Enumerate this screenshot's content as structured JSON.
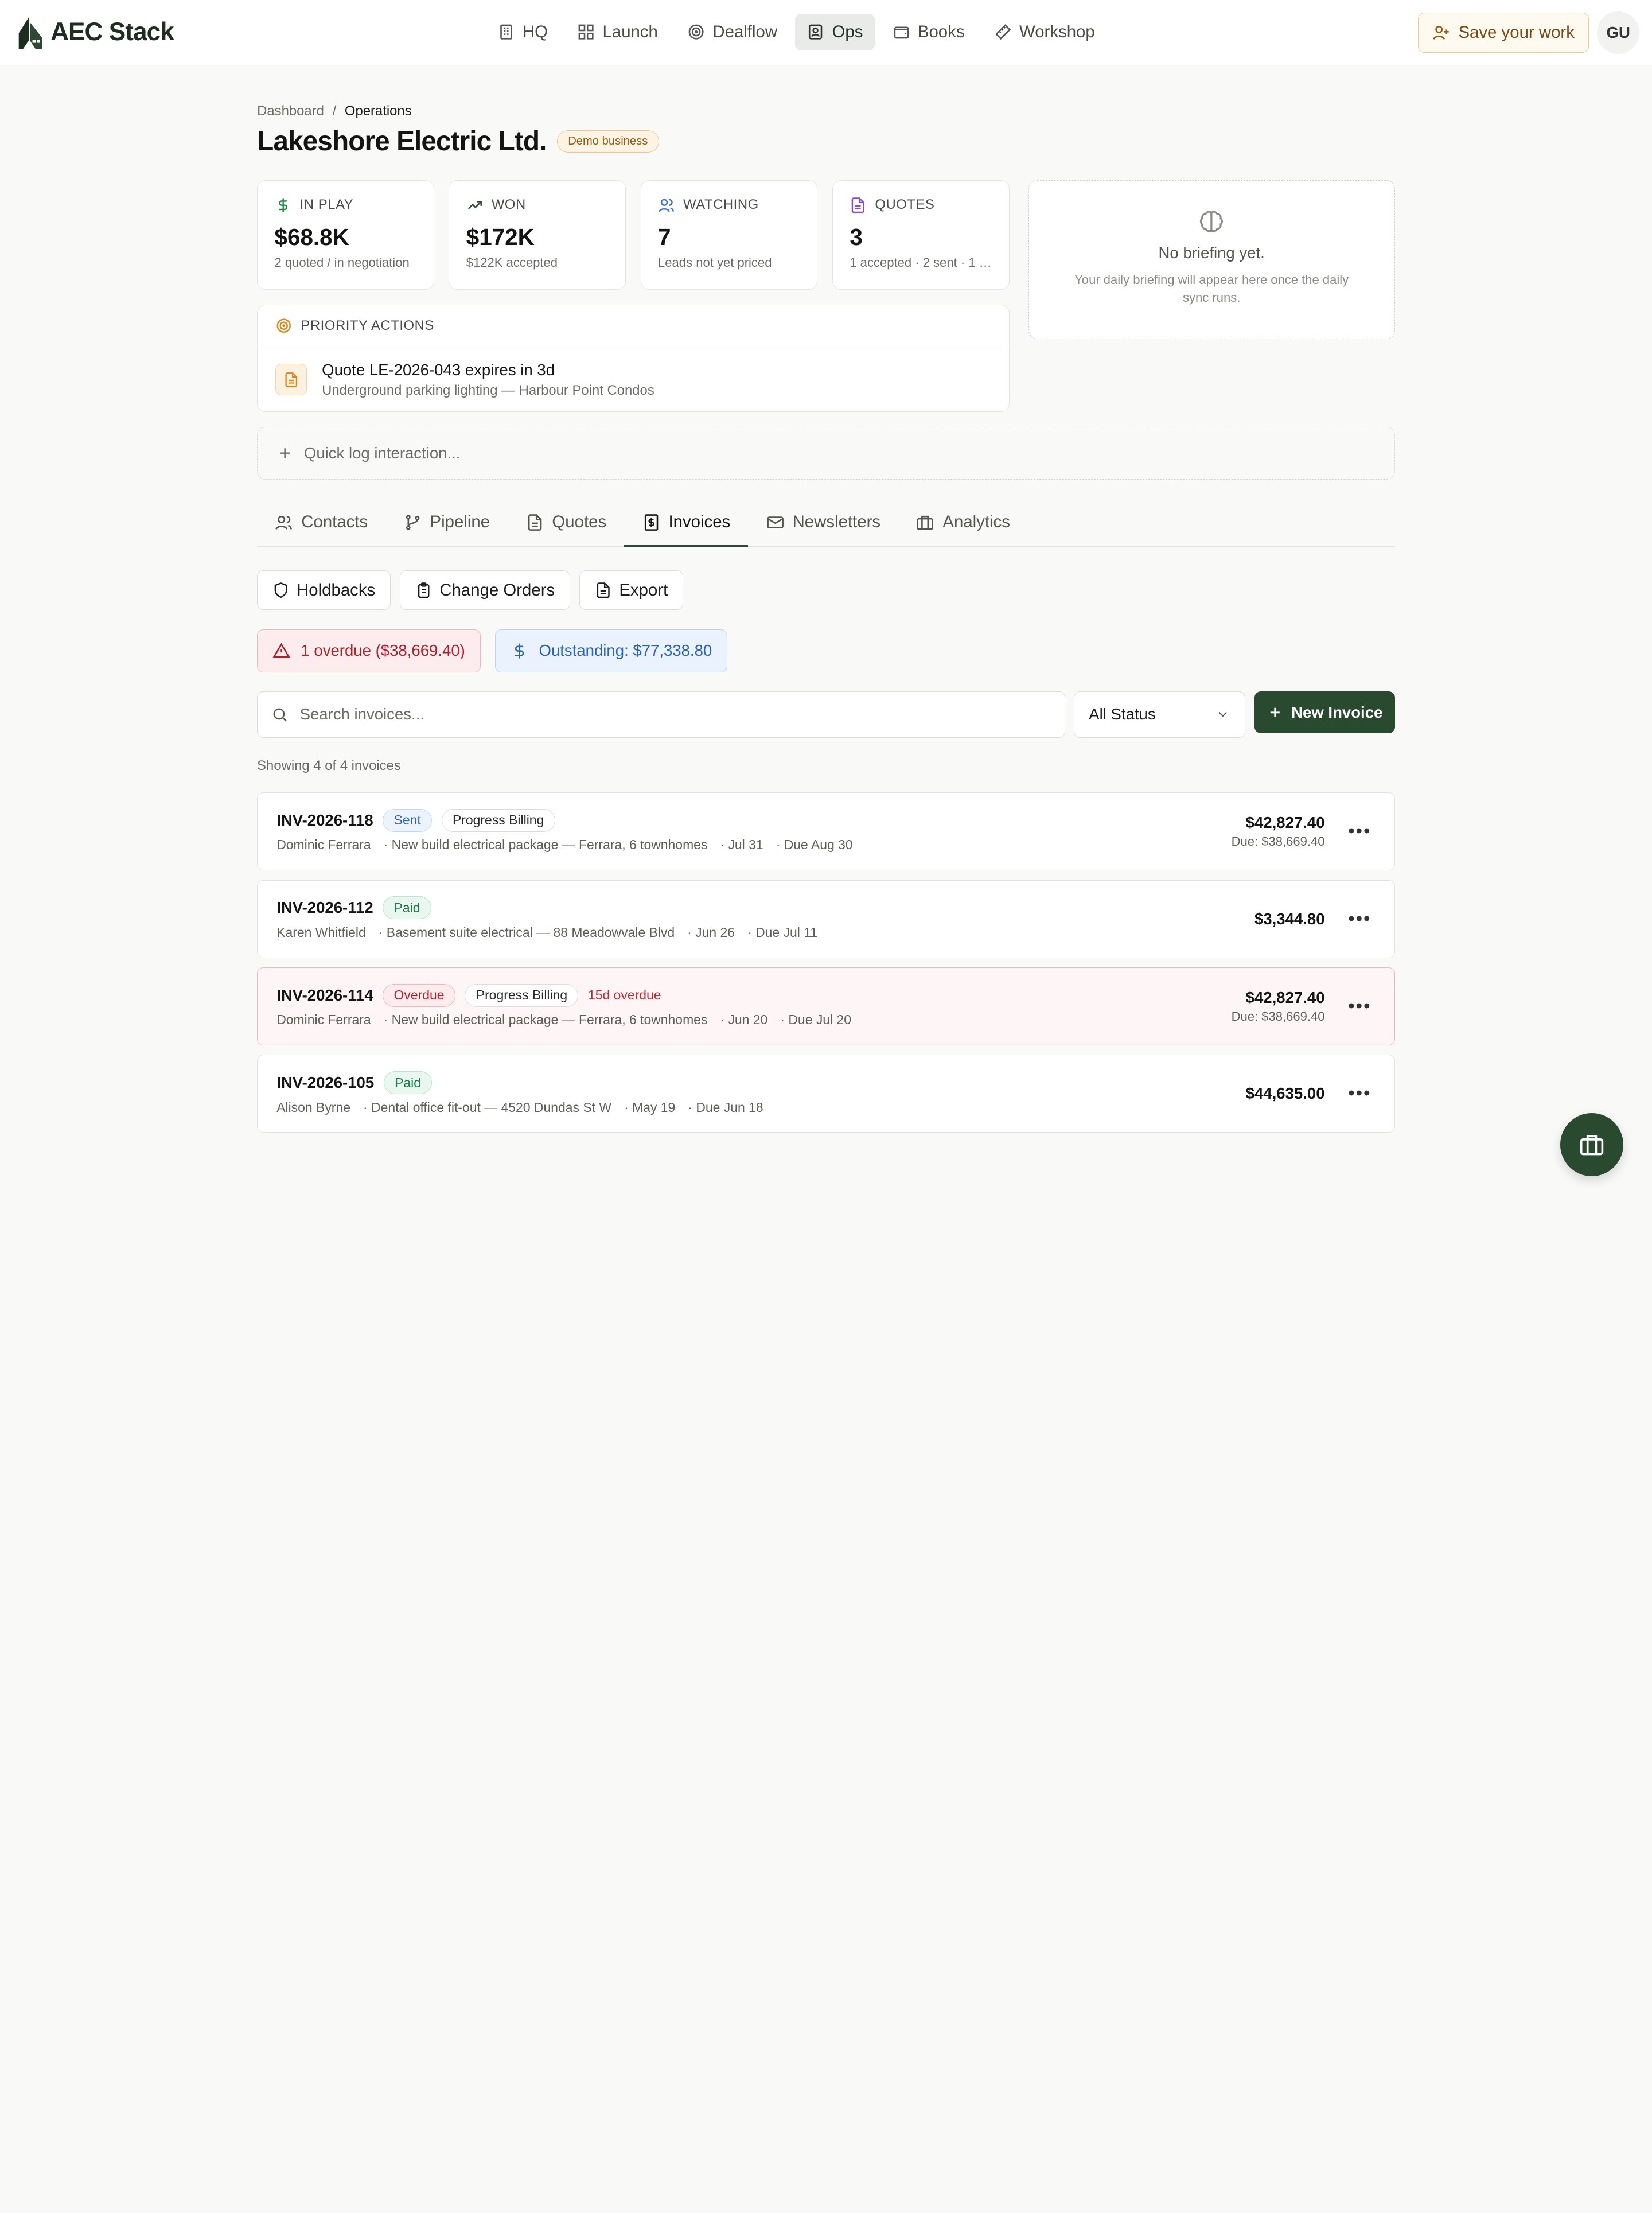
{
  "app": {
    "brand": "AEC Stack",
    "nav": [
      "HQ",
      "Launch",
      "Dealflow",
      "Ops",
      "Books",
      "Workshop"
    ],
    "active_nav": "Ops",
    "save_label": "Save your work",
    "user_initials": "GU"
  },
  "breadcrumb": {
    "root": "Dashboard",
    "sep": "/",
    "current": "Operations"
  },
  "page": {
    "title": "Lakeshore Electric Ltd.",
    "badge": "Demo business"
  },
  "stats": [
    {
      "label": "IN PLAY",
      "value": "$68.8K",
      "sub": "2 quoted / in negotiation",
      "icon": "dollar-icon",
      "color": "#2a8a4a"
    },
    {
      "label": "WON",
      "value": "$172K",
      "sub": "$122K accepted",
      "icon": "trending-up-icon",
      "color": "#2a4a30"
    },
    {
      "label": "WATCHING",
      "value": "7",
      "sub": "Leads not yet priced",
      "icon": "users-icon",
      "color": "#3a6fd8"
    },
    {
      "label": "QUOTES",
      "value": "3",
      "sub": "1 accepted · 2 sent · 1 d...",
      "icon": "file-icon",
      "color": "#8a4ad8"
    }
  ],
  "briefing": {
    "title": "No briefing yet.",
    "sub": "Your daily briefing will appear here once the daily sync runs."
  },
  "priority": {
    "heading": "PRIORITY ACTIONS",
    "items": [
      {
        "title": "Quote LE-2026-043 expires in 3d",
        "sub": "Underground parking lighting — Harbour Point Condos"
      }
    ]
  },
  "quicklog": {
    "label": "Quick log interaction..."
  },
  "tabs": [
    "Contacts",
    "Pipeline",
    "Quotes",
    "Invoices",
    "Newsletters",
    "Analytics"
  ],
  "active_tab": "Invoices",
  "subactions": [
    "Holdbacks",
    "Change Orders",
    "Export"
  ],
  "alerts": {
    "overdue": "1 overdue ($38,669.40)",
    "outstanding": "Outstanding: $77,338.80"
  },
  "search": {
    "placeholder": "Search invoices..."
  },
  "status_filter": {
    "selected": "All Status"
  },
  "new_invoice_label": "New Invoice",
  "showing": "Showing 4 of 4 invoices",
  "invoices": [
    {
      "number": "INV-2026-118",
      "status": "Sent",
      "type": "Progress Billing",
      "note": "",
      "client": "Dominic Ferrara",
      "project": "· New build electrical package — Ferrara, 6 townhomes",
      "date": "· Jul 31",
      "due": "· Due Aug 30",
      "total": "$42,827.40",
      "due_amount": "Due: $38,669.40"
    },
    {
      "number": "INV-2026-112",
      "status": "Paid",
      "type": "",
      "note": "",
      "client": "Karen Whitfield",
      "project": "· Basement suite electrical — 88 Meadowvale Blvd",
      "date": "· Jun 26",
      "due": "· Due Jul 11",
      "total": "$3,344.80",
      "due_amount": ""
    },
    {
      "number": "INV-2026-114",
      "status": "Overdue",
      "type": "Progress Billing",
      "note": "15d overdue",
      "client": "Dominic Ferrara",
      "project": "· New build electrical package — Ferrara, 6 townhomes",
      "date": "· Jun 20",
      "due": "· Due Jul 20",
      "total": "$42,827.40",
      "due_amount": "Due: $38,669.40"
    },
    {
      "number": "INV-2026-105",
      "status": "Paid",
      "type": "",
      "note": "",
      "client": "Alison Byrne",
      "project": "· Dental office fit-out — 4520 Dundas St W",
      "date": "· May 19",
      "due": "· Due Jun 18",
      "total": "$44,635.00",
      "due_amount": ""
    }
  ],
  "colors": {
    "primary": "#2a4a30",
    "danger": "#b4202a",
    "info": "#2a62bc",
    "warning": "#d9861a"
  }
}
